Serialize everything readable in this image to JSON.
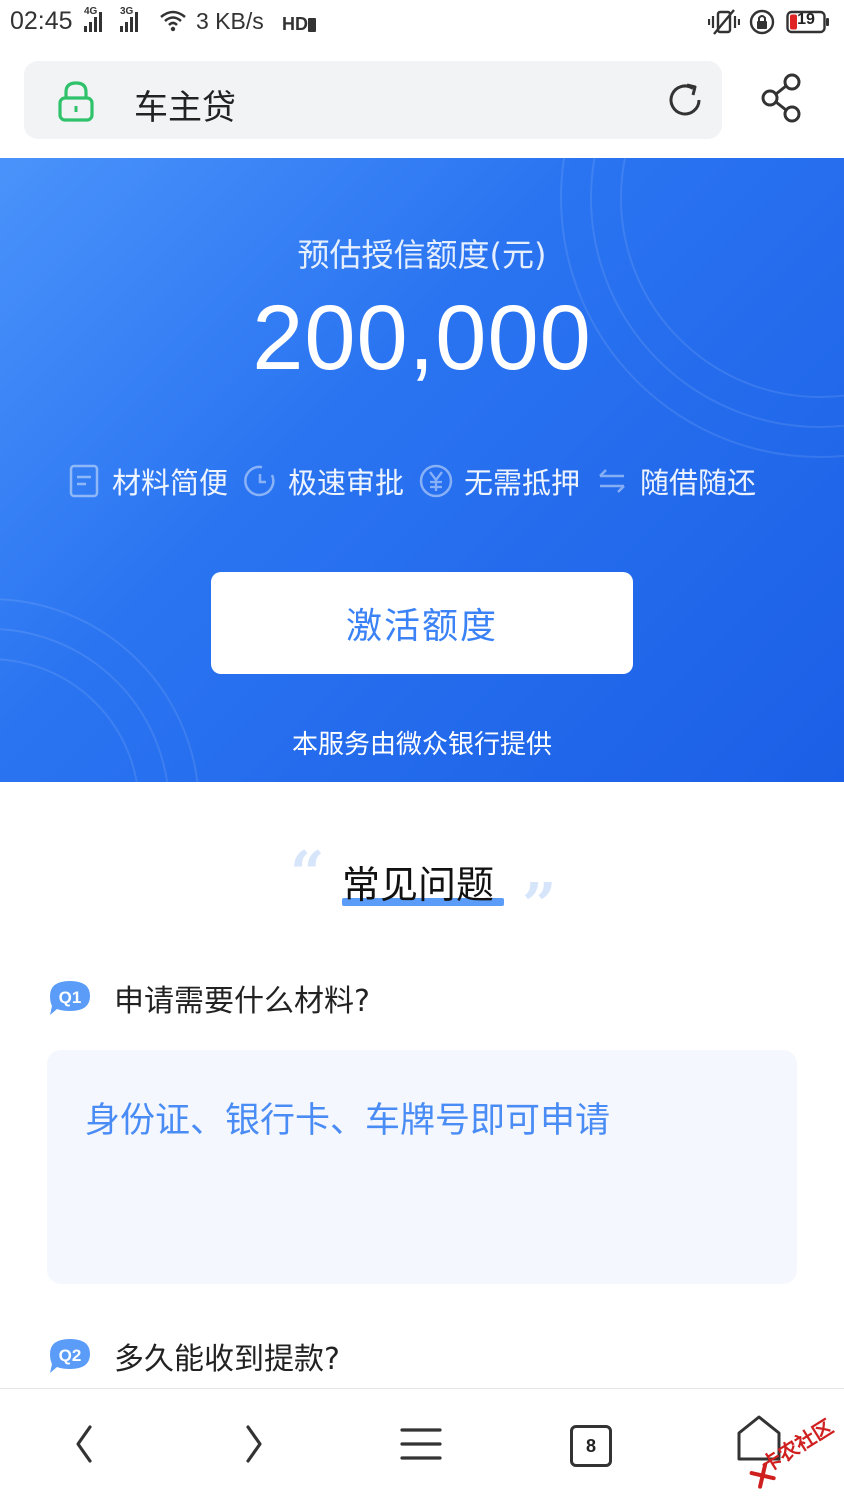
{
  "status_bar": {
    "time": "02:45",
    "net1": "4G",
    "net2": "3G",
    "speed": "3 KB/s",
    "battery": "19"
  },
  "address_bar": {
    "title": "车主贷"
  },
  "hero": {
    "label": "预估授信额度(元)",
    "amount": "200,000",
    "features": [
      {
        "icon": "document-icon",
        "label": "材料简便"
      },
      {
        "icon": "clock-icon",
        "label": "极速审批"
      },
      {
        "icon": "yuan-icon",
        "label": "无需抵押"
      },
      {
        "icon": "swap-arrows-icon",
        "label": "随借随还"
      }
    ],
    "button": "激活额度",
    "provider": "本服务由微众银行提供"
  },
  "faq": {
    "title": "常见问题",
    "items": [
      {
        "badge": "Q1",
        "question": "申请需要什么材料?",
        "answer": "身份证、银行卡、车牌号即可申请"
      },
      {
        "badge": "Q2",
        "question": "多久能收到提款?"
      }
    ]
  },
  "bottom_nav": {
    "tab_count": "8",
    "watermark": "卡农社区"
  },
  "colors": {
    "hero_start": "#4a93fb",
    "hero_end": "#1b5fe6",
    "accent_blue": "#4a8cf5",
    "answer_bg": "#f4f7fd",
    "lock_green": "#2fc26b"
  }
}
